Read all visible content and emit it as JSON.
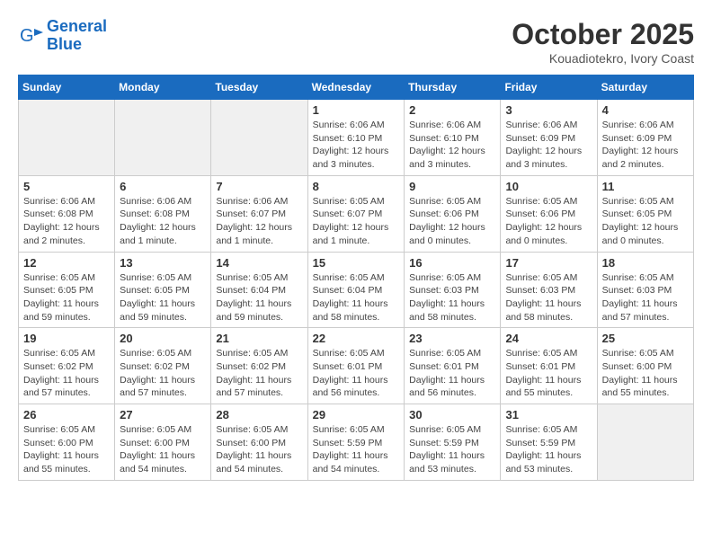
{
  "header": {
    "logo_line1": "General",
    "logo_line2": "Blue",
    "month": "October 2025",
    "location": "Kouadiotekro, Ivory Coast"
  },
  "weekdays": [
    "Sunday",
    "Monday",
    "Tuesday",
    "Wednesday",
    "Thursday",
    "Friday",
    "Saturday"
  ],
  "weeks": [
    [
      {
        "day": "",
        "info": ""
      },
      {
        "day": "",
        "info": ""
      },
      {
        "day": "",
        "info": ""
      },
      {
        "day": "1",
        "info": "Sunrise: 6:06 AM\nSunset: 6:10 PM\nDaylight: 12 hours and 3 minutes."
      },
      {
        "day": "2",
        "info": "Sunrise: 6:06 AM\nSunset: 6:10 PM\nDaylight: 12 hours and 3 minutes."
      },
      {
        "day": "3",
        "info": "Sunrise: 6:06 AM\nSunset: 6:09 PM\nDaylight: 12 hours and 3 minutes."
      },
      {
        "day": "4",
        "info": "Sunrise: 6:06 AM\nSunset: 6:09 PM\nDaylight: 12 hours and 2 minutes."
      }
    ],
    [
      {
        "day": "5",
        "info": "Sunrise: 6:06 AM\nSunset: 6:08 PM\nDaylight: 12 hours and 2 minutes."
      },
      {
        "day": "6",
        "info": "Sunrise: 6:06 AM\nSunset: 6:08 PM\nDaylight: 12 hours and 1 minute."
      },
      {
        "day": "7",
        "info": "Sunrise: 6:06 AM\nSunset: 6:07 PM\nDaylight: 12 hours and 1 minute."
      },
      {
        "day": "8",
        "info": "Sunrise: 6:05 AM\nSunset: 6:07 PM\nDaylight: 12 hours and 1 minute."
      },
      {
        "day": "9",
        "info": "Sunrise: 6:05 AM\nSunset: 6:06 PM\nDaylight: 12 hours and 0 minutes."
      },
      {
        "day": "10",
        "info": "Sunrise: 6:05 AM\nSunset: 6:06 PM\nDaylight: 12 hours and 0 minutes."
      },
      {
        "day": "11",
        "info": "Sunrise: 6:05 AM\nSunset: 6:05 PM\nDaylight: 12 hours and 0 minutes."
      }
    ],
    [
      {
        "day": "12",
        "info": "Sunrise: 6:05 AM\nSunset: 6:05 PM\nDaylight: 11 hours and 59 minutes."
      },
      {
        "day": "13",
        "info": "Sunrise: 6:05 AM\nSunset: 6:05 PM\nDaylight: 11 hours and 59 minutes."
      },
      {
        "day": "14",
        "info": "Sunrise: 6:05 AM\nSunset: 6:04 PM\nDaylight: 11 hours and 59 minutes."
      },
      {
        "day": "15",
        "info": "Sunrise: 6:05 AM\nSunset: 6:04 PM\nDaylight: 11 hours and 58 minutes."
      },
      {
        "day": "16",
        "info": "Sunrise: 6:05 AM\nSunset: 6:03 PM\nDaylight: 11 hours and 58 minutes."
      },
      {
        "day": "17",
        "info": "Sunrise: 6:05 AM\nSunset: 6:03 PM\nDaylight: 11 hours and 58 minutes."
      },
      {
        "day": "18",
        "info": "Sunrise: 6:05 AM\nSunset: 6:03 PM\nDaylight: 11 hours and 57 minutes."
      }
    ],
    [
      {
        "day": "19",
        "info": "Sunrise: 6:05 AM\nSunset: 6:02 PM\nDaylight: 11 hours and 57 minutes."
      },
      {
        "day": "20",
        "info": "Sunrise: 6:05 AM\nSunset: 6:02 PM\nDaylight: 11 hours and 57 minutes."
      },
      {
        "day": "21",
        "info": "Sunrise: 6:05 AM\nSunset: 6:02 PM\nDaylight: 11 hours and 57 minutes."
      },
      {
        "day": "22",
        "info": "Sunrise: 6:05 AM\nSunset: 6:01 PM\nDaylight: 11 hours and 56 minutes."
      },
      {
        "day": "23",
        "info": "Sunrise: 6:05 AM\nSunset: 6:01 PM\nDaylight: 11 hours and 56 minutes."
      },
      {
        "day": "24",
        "info": "Sunrise: 6:05 AM\nSunset: 6:01 PM\nDaylight: 11 hours and 55 minutes."
      },
      {
        "day": "25",
        "info": "Sunrise: 6:05 AM\nSunset: 6:00 PM\nDaylight: 11 hours and 55 minutes."
      }
    ],
    [
      {
        "day": "26",
        "info": "Sunrise: 6:05 AM\nSunset: 6:00 PM\nDaylight: 11 hours and 55 minutes."
      },
      {
        "day": "27",
        "info": "Sunrise: 6:05 AM\nSunset: 6:00 PM\nDaylight: 11 hours and 54 minutes."
      },
      {
        "day": "28",
        "info": "Sunrise: 6:05 AM\nSunset: 6:00 PM\nDaylight: 11 hours and 54 minutes."
      },
      {
        "day": "29",
        "info": "Sunrise: 6:05 AM\nSunset: 5:59 PM\nDaylight: 11 hours and 54 minutes."
      },
      {
        "day": "30",
        "info": "Sunrise: 6:05 AM\nSunset: 5:59 PM\nDaylight: 11 hours and 53 minutes."
      },
      {
        "day": "31",
        "info": "Sunrise: 6:05 AM\nSunset: 5:59 PM\nDaylight: 11 hours and 53 minutes."
      },
      {
        "day": "",
        "info": ""
      }
    ]
  ]
}
